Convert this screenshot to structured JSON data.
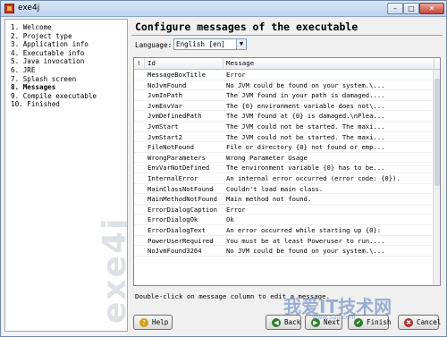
{
  "window": {
    "title": "exe4j",
    "min": "–",
    "max": "□",
    "close": "✕"
  },
  "steps": [
    "1. Welcome",
    "2. Project type",
    "3. Application info",
    "4. Executable info",
    "5. Java invocation",
    "6. JRE",
    "7. Splash screen",
    "8. Messages",
    "9. Compile executable",
    "10. Finished"
  ],
  "brand": "exe4j",
  "heading": "Configure messages of the executable",
  "language": {
    "label": "Language:",
    "value": "English [en]",
    "arrow": "▼"
  },
  "table": {
    "headers": [
      "!",
      "Id",
      "Message"
    ],
    "rows": [
      [
        "MessageBoxTitle",
        "Error"
      ],
      [
        "NoJvmFound",
        "No JVM could be found on your system.\\..."
      ],
      [
        "JvmInPath",
        "The JVM found in your path is damaged...."
      ],
      [
        "JvmEnvVar",
        "The {0} environment variable does not\\..."
      ],
      [
        "JvmDefinedPath",
        "The JVM found at {0} is damaged.\\nPlea..."
      ],
      [
        "JvmStart",
        "The JVM could not be started. The maxi..."
      ],
      [
        "JvmStart2",
        "The JVM could not be started. The maxi..."
      ],
      [
        "FileNotFound",
        "File or directory {0} not found or emp..."
      ],
      [
        "WrongParameters",
        "Wrong Parameter Usage"
      ],
      [
        "EnvVarNotDefined",
        "The environment variable {0} has to be..."
      ],
      [
        "InternalError",
        "An internal error occurred (error code: {0})."
      ],
      [
        "MainClassNotFound",
        "Couldn't load main class."
      ],
      [
        "MainMethodNotFound",
        "Main method not found."
      ],
      [
        "ErrorDialogCaption",
        "Error"
      ],
      [
        "ErrorDialogOk",
        "Ok"
      ],
      [
        "ErrorDialogText",
        "An error occurred while starting up {0}:"
      ],
      [
        "PowerUserRequired",
        "You must be at least Poweruser to run...."
      ],
      [
        "NoJvmFound3264",
        "No JVM could be found on your system.\\..."
      ]
    ]
  },
  "hint": "Double-click on message column to edit a message.",
  "buttons": {
    "help": "Help",
    "back": "Back",
    "next": "Next",
    "finish": "Finish",
    "cancel": "Cancel"
  },
  "icons": {
    "help": "?",
    "back": "◀",
    "next": "▶",
    "finish": "✔",
    "cancel": "✖"
  },
  "watermark": {
    "main": "我爱IT技术网",
    "sub": "www.52ij.com"
  }
}
